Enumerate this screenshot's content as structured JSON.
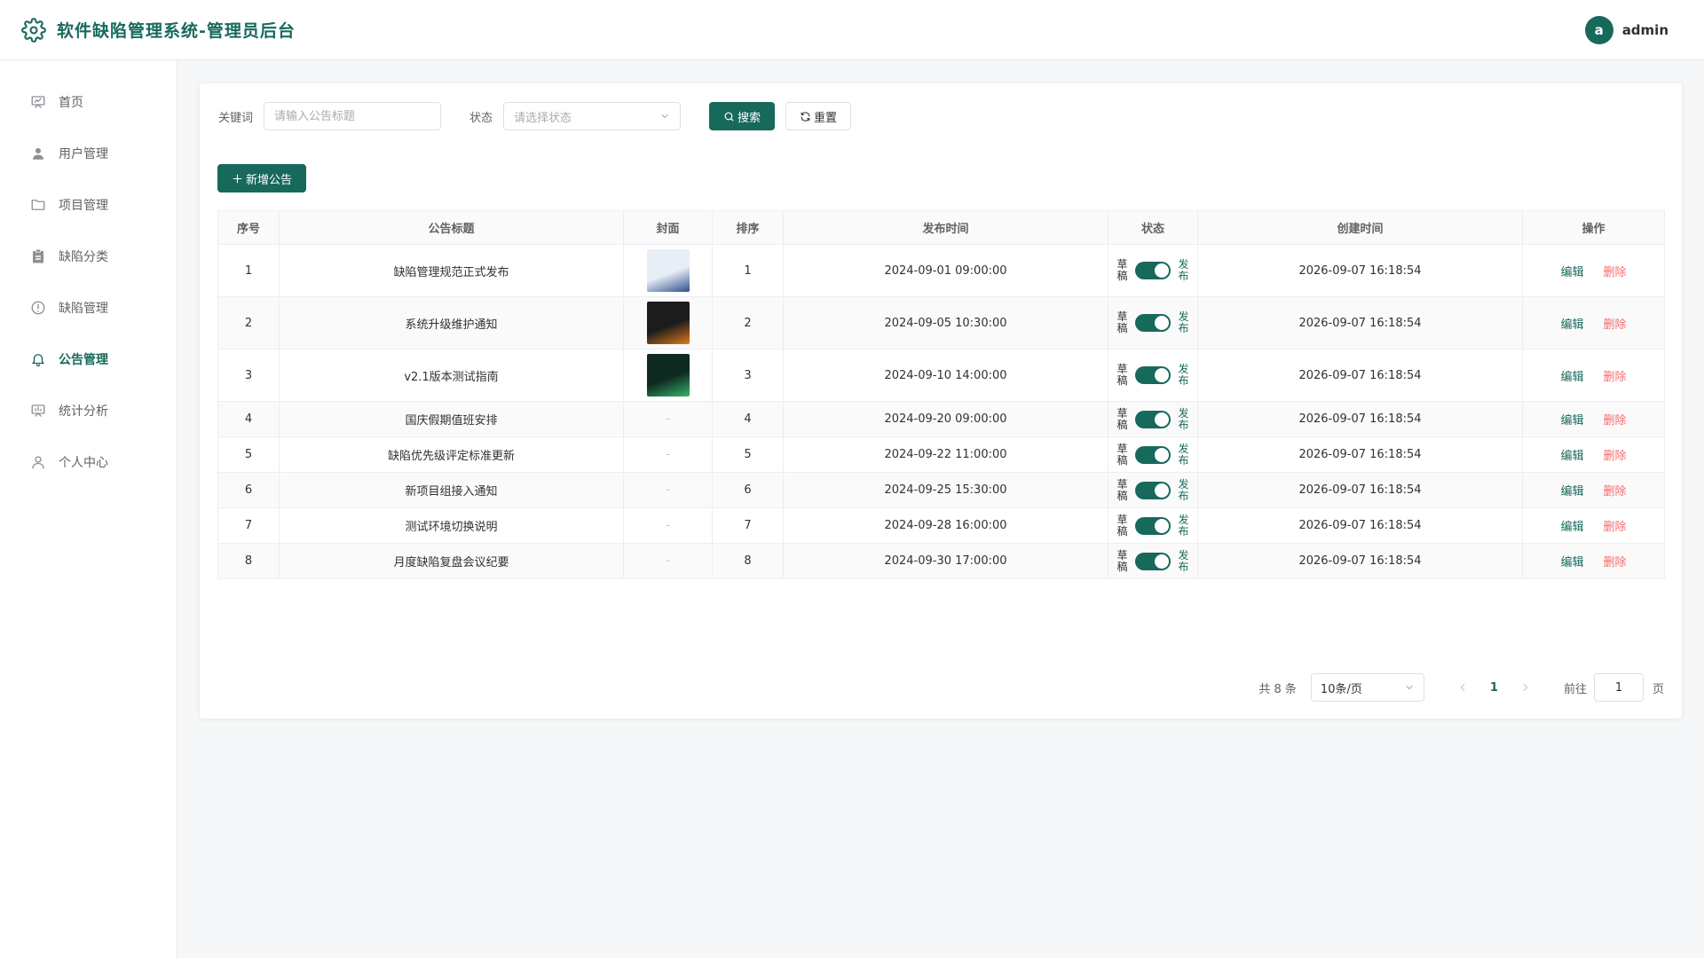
{
  "app": {
    "title": "软件缺陷管理系统-管理员后台"
  },
  "user": {
    "avatar_letter": "a",
    "name": "admin"
  },
  "sidebar": {
    "items": [
      {
        "label": "首页",
        "icon": "presentation-icon",
        "active": false
      },
      {
        "label": "用户管理",
        "icon": "user-icon",
        "active": false
      },
      {
        "label": "项目管理",
        "icon": "folder-icon",
        "active": false
      },
      {
        "label": "缺陷分类",
        "icon": "clipboard-icon",
        "active": false
      },
      {
        "label": "缺陷管理",
        "icon": "warning-circle-icon",
        "active": false
      },
      {
        "label": "公告管理",
        "icon": "bell-icon",
        "active": true
      },
      {
        "label": "统计分析",
        "icon": "chart-board-icon",
        "active": false
      },
      {
        "label": "个人中心",
        "icon": "user-outline-icon",
        "active": false
      }
    ]
  },
  "filters": {
    "keyword_label": "关键词",
    "keyword_placeholder": "请输入公告标题",
    "status_label": "状态",
    "status_placeholder": "请选择状态",
    "search_label": "搜索",
    "reset_label": "重置"
  },
  "toolbar": {
    "add_label": "新增公告"
  },
  "table": {
    "headers": [
      "序号",
      "公告标题",
      "封面",
      "排序",
      "发布时间",
      "状态",
      "创建时间",
      "操作"
    ],
    "status_off": "草稿",
    "status_on": "发布",
    "edit_label": "编辑",
    "delete_label": "删除",
    "empty_cover": "-",
    "rows": [
      {
        "no": "1",
        "title": "缺陷管理规范正式发布",
        "cover": "image",
        "cover_colors": [
          "#e8eef6",
          "#2c4f8c"
        ],
        "sort": "1",
        "publish_time": "2024-09-01 09:00:00",
        "published": true,
        "created": "2026-09-07 16:18:54"
      },
      {
        "no": "2",
        "title": "系统升级维护通知",
        "cover": "image",
        "cover_colors": [
          "#1c1c1c",
          "#e07a1c"
        ],
        "sort": "2",
        "publish_time": "2024-09-05 10:30:00",
        "published": true,
        "created": "2026-09-07 16:18:54"
      },
      {
        "no": "3",
        "title": "v2.1版本测试指南",
        "cover": "image",
        "cover_colors": [
          "#0e2a22",
          "#39b36b"
        ],
        "sort": "3",
        "publish_time": "2024-09-10 14:00:00",
        "published": true,
        "created": "2026-09-07 16:18:54"
      },
      {
        "no": "4",
        "title": "国庆假期值班安排",
        "cover": "none",
        "sort": "4",
        "publish_time": "2024-09-20 09:00:00",
        "published": true,
        "created": "2026-09-07 16:18:54"
      },
      {
        "no": "5",
        "title": "缺陷优先级评定标准更新",
        "cover": "none",
        "sort": "5",
        "publish_time": "2024-09-22 11:00:00",
        "published": true,
        "created": "2026-09-07 16:18:54"
      },
      {
        "no": "6",
        "title": "新项目组接入通知",
        "cover": "none",
        "sort": "6",
        "publish_time": "2024-09-25 15:30:00",
        "published": true,
        "created": "2026-09-07 16:18:54"
      },
      {
        "no": "7",
        "title": "测试环境切换说明",
        "cover": "none",
        "sort": "7",
        "publish_time": "2024-09-28 16:00:00",
        "published": true,
        "created": "2026-09-07 16:18:54"
      },
      {
        "no": "8",
        "title": "月度缺陷复盘会议纪要",
        "cover": "none",
        "sort": "8",
        "publish_time": "2024-09-30 17:00:00",
        "published": true,
        "created": "2026-09-07 16:18:54"
      }
    ]
  },
  "pagination": {
    "total": "共 8 条",
    "page_size": "10条/页",
    "current_page": "1",
    "goto_label": "前往",
    "goto_value": "1",
    "page_unit": "页"
  },
  "colors": {
    "brand": "#17695c",
    "danger": "#f56c6c"
  }
}
